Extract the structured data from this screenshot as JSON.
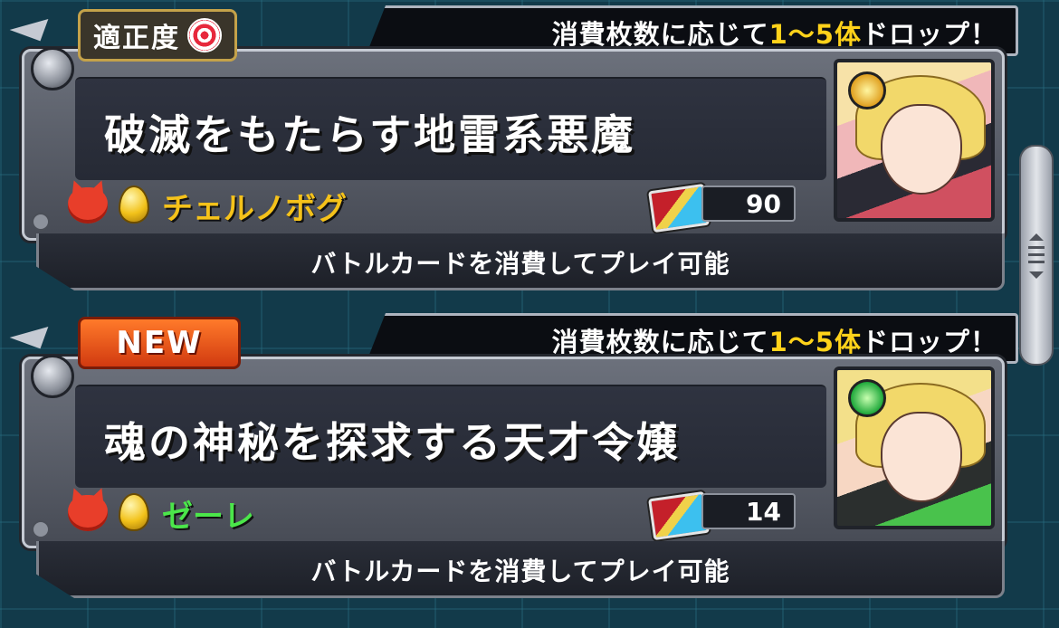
{
  "quests": [
    {
      "banner": {
        "pre": "消費枚数に応じて",
        "highlight": "1〜5体",
        "post": "ドロップ！"
      },
      "badge": {
        "type": "fit",
        "label": "適正度"
      },
      "title": "破滅をもたらす地雷系悪魔",
      "enemy_name": "チェルノボグ",
      "enemy_name_color": "#f5c21a",
      "card_count": "90",
      "footer": "バトルカードを消費してプレイ可能",
      "portrait_element": "light"
    },
    {
      "banner": {
        "pre": "消費枚数に応じて",
        "highlight": "1〜5体",
        "post": "ドロップ！"
      },
      "badge": {
        "type": "new",
        "label": "NEW"
      },
      "title": "魂の神秘を探求する天才令嬢",
      "enemy_name": "ゼーレ",
      "enemy_name_color": "#4be64a",
      "card_count": "14",
      "footer": "バトルカードを消費してプレイ可能",
      "portrait_element": "wood"
    }
  ],
  "icons": {
    "attribute": "demon-icon",
    "egg": "egg-icon",
    "battle_card": "battle-card-icon",
    "fit": "target-icon"
  }
}
